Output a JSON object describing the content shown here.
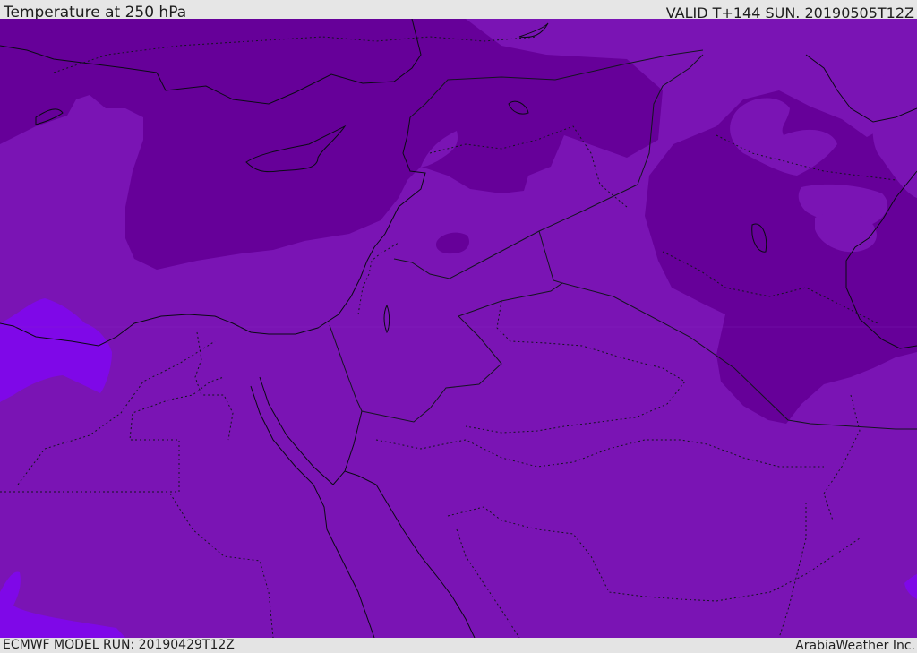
{
  "header": {
    "title": "Temperature at 250 hPa",
    "valid": "VALID T+144 SUN. 20190505T12Z"
  },
  "footer": {
    "model_run": "ECMWF MODEL RUN: 20190429T12Z",
    "credit": "ArabiaWeather Inc."
  },
  "map": {
    "colors": {
      "base_field": "#7a14b4",
      "cold_field": "#650499",
      "warm_field": "#7f08e8",
      "light_field": "#8a1ec4",
      "coastline": "#0a0a14",
      "border": "#141420"
    }
  }
}
